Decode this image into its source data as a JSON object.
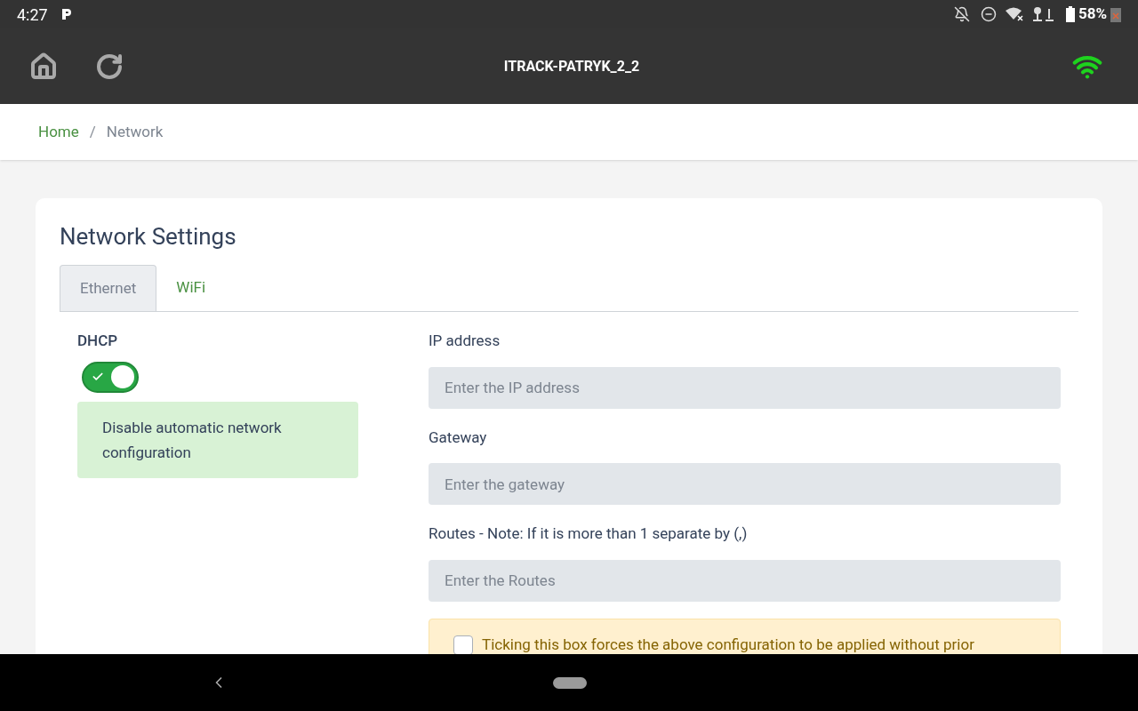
{
  "status_bar": {
    "time": "4:27",
    "battery": "58%"
  },
  "app_bar": {
    "title": "ITRACK-PATRYK_2_2"
  },
  "breadcrumb": [
    {
      "label": "Home",
      "kind": "link"
    },
    {
      "label": "/",
      "kind": "separator"
    },
    {
      "label": "Network",
      "kind": "current"
    }
  ],
  "card": {
    "title": "Network Settings",
    "tabs": [
      {
        "label": "Ethernet",
        "selected": true
      },
      {
        "label": "WiFi",
        "selected": false
      }
    ],
    "dhcp": {
      "label": "DHCP",
      "on": true,
      "note": "Disable automatic network configuration"
    },
    "fields": [
      {
        "label": "IP address",
        "placeholder": "Enter the IP address"
      },
      {
        "label": "Gateway",
        "placeholder": "Enter the gateway"
      },
      {
        "label": "Routes - Note: If it is more than 1 separate by (,)",
        "placeholder": "Enter the Routes"
      }
    ],
    "force": {
      "checked": false,
      "text": "Ticking this box forces the above configuration to be applied without prior"
    }
  }
}
